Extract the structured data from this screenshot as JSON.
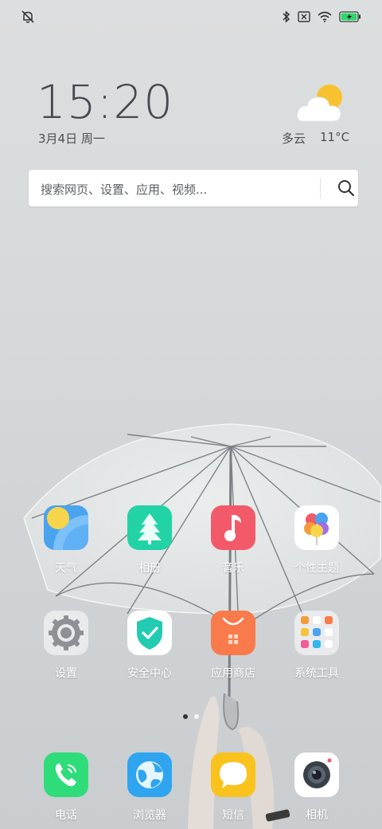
{
  "status_bar": {
    "left_icon": "bell-off-icon",
    "right_icons": [
      "bluetooth-icon",
      "no-sim-icon",
      "wifi-icon",
      "battery-charging-icon"
    ]
  },
  "clock": {
    "time": "15:20",
    "date": "3月4日 周一"
  },
  "weather": {
    "condition": "多云",
    "temperature": "11°C",
    "icon": "partly-cloudy-icon"
  },
  "search": {
    "placeholder": "搜索网页、设置、应用、视频..."
  },
  "apps_row1": [
    {
      "label": "天气",
      "icon": "weather-app-icon"
    },
    {
      "label": "相册",
      "icon": "gallery-app-icon"
    },
    {
      "label": "音乐",
      "icon": "music-app-icon"
    },
    {
      "label": "个性主题",
      "icon": "themes-app-icon"
    }
  ],
  "apps_row2": [
    {
      "label": "设置",
      "icon": "settings-app-icon"
    },
    {
      "label": "安全中心",
      "icon": "security-app-icon"
    },
    {
      "label": "应用商店",
      "icon": "app-store-icon"
    },
    {
      "label": "系统工具",
      "icon": "system-tools-folder-icon"
    }
  ],
  "dock": [
    {
      "label": "电话",
      "icon": "phone-app-icon"
    },
    {
      "label": "浏览器",
      "icon": "browser-app-icon"
    },
    {
      "label": "短信",
      "icon": "messages-app-icon"
    },
    {
      "label": "相机",
      "icon": "camera-app-icon"
    }
  ],
  "page_indicator": {
    "pages": 2,
    "active": 1
  },
  "colors": {
    "clock_text": "#444a52",
    "accent_green": "#2fd66b"
  }
}
